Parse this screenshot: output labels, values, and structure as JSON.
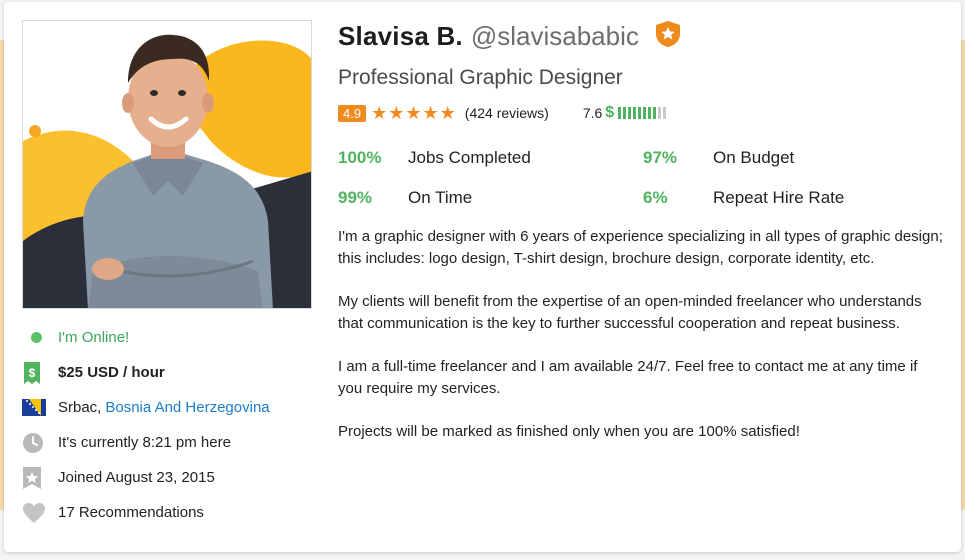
{
  "profile": {
    "name": "Slavisa B.",
    "username": "@slavisababic",
    "title": "Professional Graphic Designer",
    "badge_icon": "preferred-freelancer-badge-icon",
    "rating": {
      "score": "4.9",
      "stars": 5,
      "reviews": "(424 reviews)",
      "earnings_score": "7.6",
      "earnings_symbol": "$",
      "earnings_level": 0.76
    }
  },
  "stats": [
    {
      "pct": "100%",
      "label": "Jobs Completed"
    },
    {
      "pct": "97%",
      "label": "On Budget"
    },
    {
      "pct": "99%",
      "label": "On Time"
    },
    {
      "pct": "6%",
      "label": "Repeat Hire Rate"
    }
  ],
  "sidebar": {
    "online": "I'm Online!",
    "rate": "$25 USD / hour",
    "city": "Srbac,",
    "country": "Bosnia And Herzegovina",
    "local_time": "It's currently 8:21 pm here",
    "joined": "Joined August 23, 2015",
    "recommendations": "17 Recommendations"
  },
  "description": [
    "I'm a graphic designer with 6 years of experience specializing in all types of graphic design; this includes: logo design, T-shirt design, brochure design, corporate identity, etc.",
    "My clients will benefit from the expertise of an open-minded freelancer who understands that communication is the key to further successful cooperation and repeat business.",
    "I am a full-time freelancer and I am available 24/7. Feel free to contact me at any time if you require my services.",
    "Projects will be marked as finished only when you are 100% satisfied!"
  ],
  "colors": {
    "accent_orange": "#f08a1d",
    "success_green": "#4fb35f",
    "link_blue": "#1a7ecb",
    "online_green": "#5dc26a"
  }
}
